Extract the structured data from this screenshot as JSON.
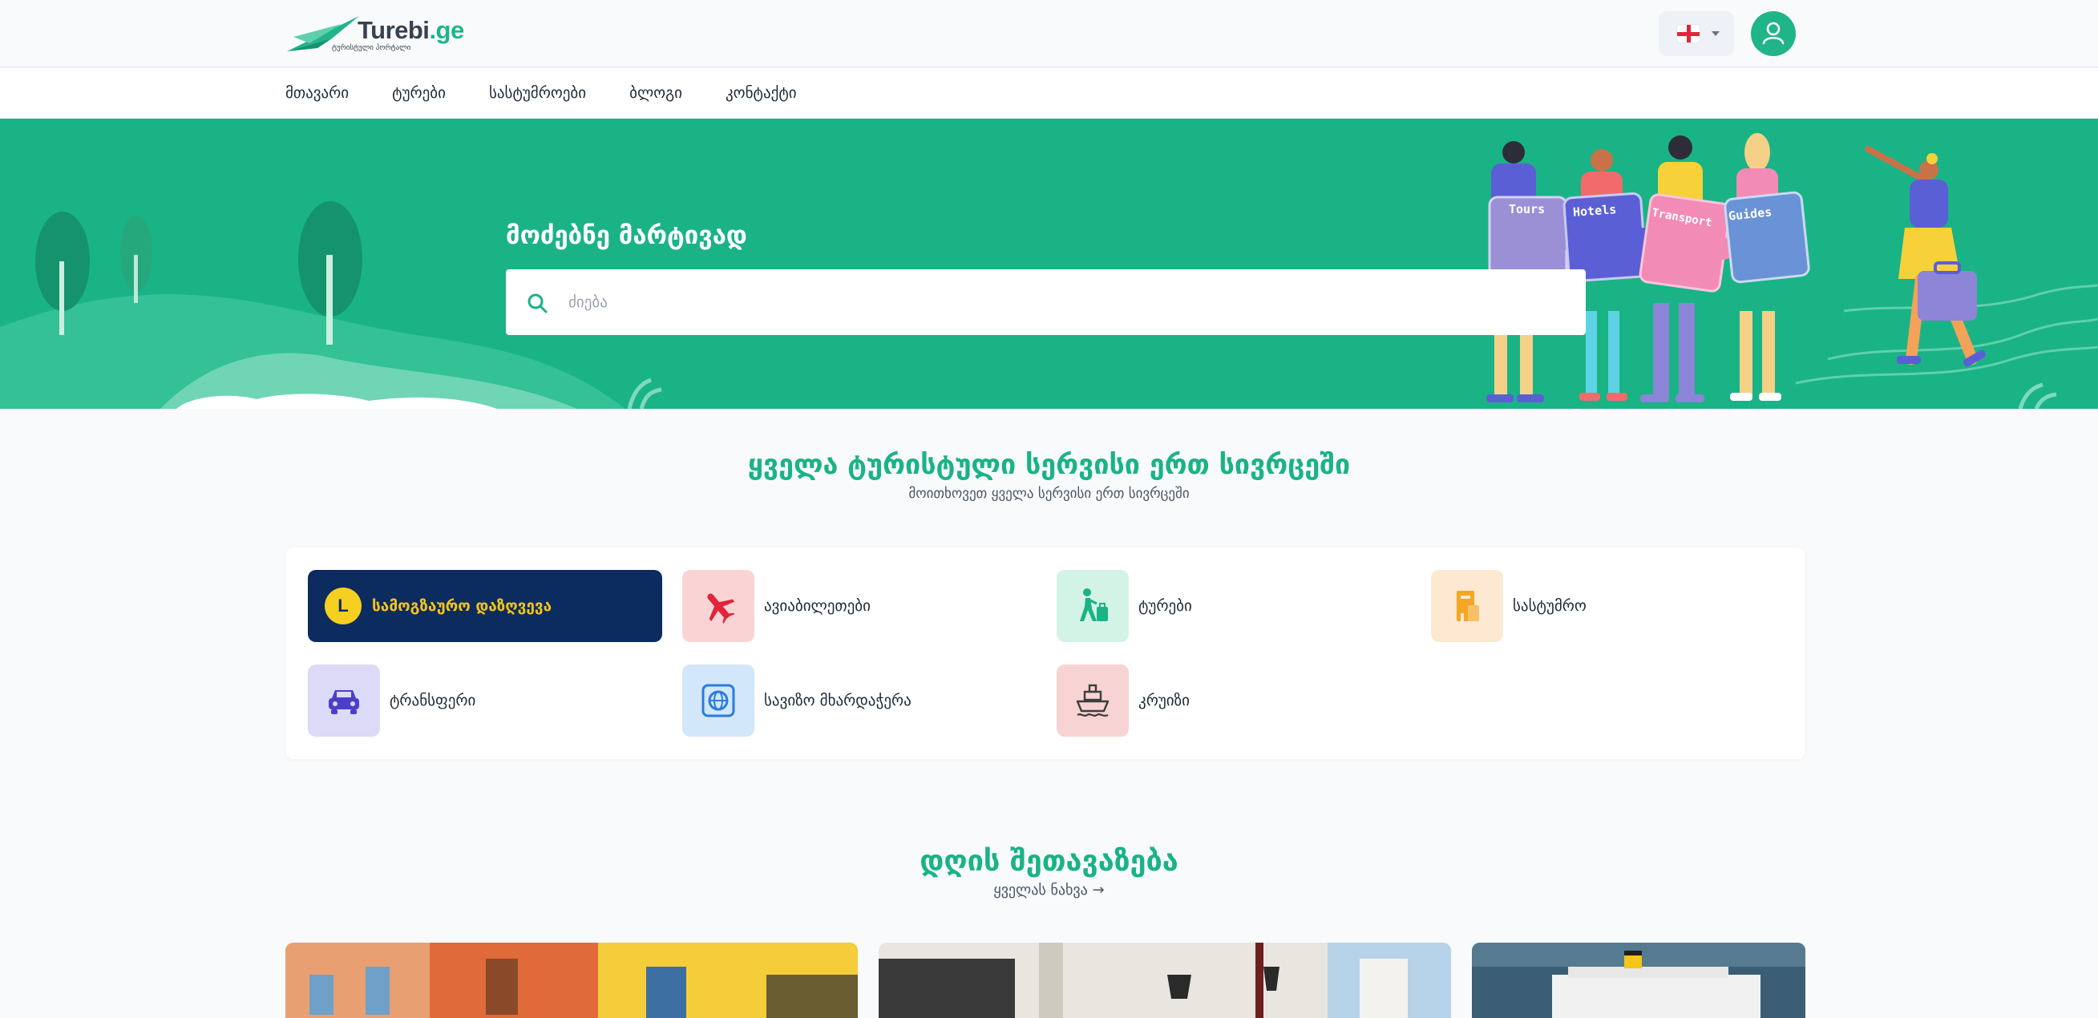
{
  "brand": {
    "name": "Turebi",
    "suffix": ".ge",
    "tagline": "ტურისტული პორტალი",
    "color": "#1fb588"
  },
  "header": {
    "language_flag": "georgia-flag-icon"
  },
  "nav": {
    "items": [
      "მთავარი",
      "ტურები",
      "სასტუმროები",
      "ბლოგი",
      "კონტაქტი"
    ]
  },
  "hero": {
    "title": "მოძებნე მარტივად",
    "search_placeholder": "ძიება",
    "puzzle_labels": [
      "Tours",
      "Hotels",
      "Transport",
      "Guides"
    ],
    "background": "#1ab385"
  },
  "services": {
    "title": "ყველა ტურისტული სერვისი ერთ სივრცეში",
    "subtitle": "მოითხოვეთ ყველა სერვისი ერთ სივრცეში",
    "items": [
      {
        "label": "სამოგზაურო დაზღვევა",
        "icon": "insurance-l-icon",
        "active": true
      },
      {
        "label": "ავიაბილეთები",
        "icon": "airplane-icon"
      },
      {
        "label": "ტურები",
        "icon": "hiker-icon"
      },
      {
        "label": "სასტუმრო",
        "icon": "hotel-building-icon"
      },
      {
        "label": "ტრანსფერი",
        "icon": "car-icon"
      },
      {
        "label": "სავიზო მხარდაჭერა",
        "icon": "globe-icon"
      },
      {
        "label": "კრუიზი",
        "icon": "cruise-ship-icon"
      }
    ]
  },
  "offers": {
    "title": "დღის შეთავაზება",
    "see_all": "ყველას ნახვა →"
  }
}
